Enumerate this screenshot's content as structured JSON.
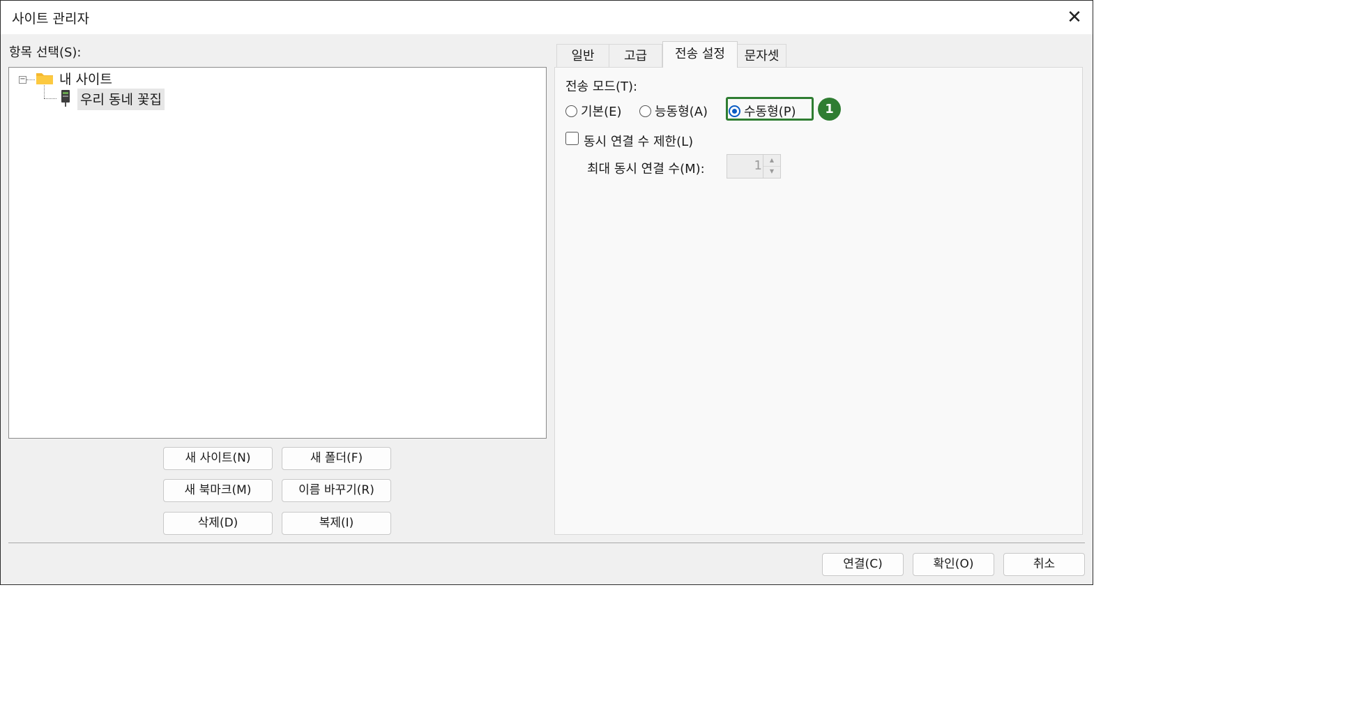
{
  "window": {
    "title": "사이트 관리자"
  },
  "left": {
    "select_label": "항목 선택(S):",
    "tree": {
      "toggle": "−",
      "root_label": "내 사이트",
      "child_label": "우리 동네 꽃집"
    },
    "buttons": {
      "new_site": "새 사이트(N)",
      "new_folder": "새 폴더(F)",
      "new_bookmark": "새 북마크(M)",
      "rename": "이름 바꾸기(R)",
      "delete": "삭제(D)",
      "duplicate": "복제(I)"
    }
  },
  "tabs": {
    "general": "일반",
    "advanced": "고급",
    "transfer": "전송 설정",
    "charset": "문자셋",
    "active_tab": "전송 설정"
  },
  "transfer": {
    "mode_label": "전송 모드(T):",
    "modes": {
      "default": "기본(E)",
      "active": "능동형(A)",
      "passive": "수동형(P)"
    },
    "selected_mode": "수동형(P)",
    "limit_label": "동시 연결 수 제한(L)",
    "limit_checked": false,
    "max_label": "최대 동시 연결 수(M):",
    "max_value": "1",
    "spin_up": "▲",
    "spin_down": "▼"
  },
  "annotation": {
    "badge": "1",
    "color": "#2f7d32"
  },
  "footer": {
    "connect": "연결(C)",
    "ok": "확인(O)",
    "cancel": "취소"
  }
}
